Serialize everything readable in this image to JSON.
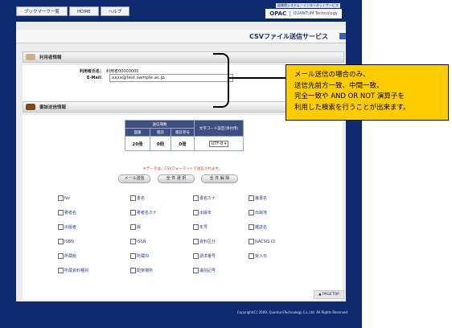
{
  "nav": {
    "bookmarks": "ブックマーク一覧",
    "home": "HOME",
    "help": "ヘルプ"
  },
  "logo": {
    "subtitle": "図書館システム・インターネットサービス",
    "brand": "OPAC",
    "company": "QUANTUM Technology"
  },
  "page": {
    "title": "CSVファイル送信サービス"
  },
  "user_section": {
    "title": "利用者情報",
    "name_label": "利用者氏名：",
    "name_value": "利用者00000000",
    "email_label": "E-Mail：",
    "email_value": "xxxx@test.sample.ac.jp"
  },
  "send_section": {
    "title": "書誌送信情報"
  },
  "stats": {
    "header": "送信冊数",
    "columns": [
      "図書",
      "雑誌",
      "雑誌巻号",
      "文字コード設定(添付用)"
    ],
    "values": [
      "20冊",
      "0冊",
      "0冊"
    ],
    "encoding": "UTF-8"
  },
  "note": "※データは、CSVフォーマットで送信されます。",
  "buttons": {
    "send": "メール送信",
    "select_all": "全 件 選 択",
    "clear_all": "全 件 解 除"
  },
  "fields": [
    "No",
    "書名",
    "書名カナ",
    "叢書名",
    "著者名",
    "著者名カナ",
    "出版年",
    "出版地",
    "出版者",
    "版",
    "年号",
    "雑誌名",
    "ISBN",
    "ISSN",
    "資料区分",
    "NACSIS ID",
    "所蔵館",
    "所蔵ID",
    "請求番号",
    "受入日",
    "所蔵資料種別",
    "配架場所",
    "識別記号"
  ],
  "pagetop": "▲ PAGETOP",
  "footer": "Copyright(C) 2009, QuantumTechnology Co.,Ltd. All Rights Reserved",
  "callout": {
    "lines": [
      "メール送信の場合のみ、",
      "送信先前方一致、中間一致、",
      "完全一致や AND OR NOT 演算子を",
      "利用した検索を行うことが出来ます。"
    ]
  },
  "colors": {
    "frame": "#0d2a6e",
    "callout": "#ffcc00",
    "header": "#3b4f80"
  }
}
